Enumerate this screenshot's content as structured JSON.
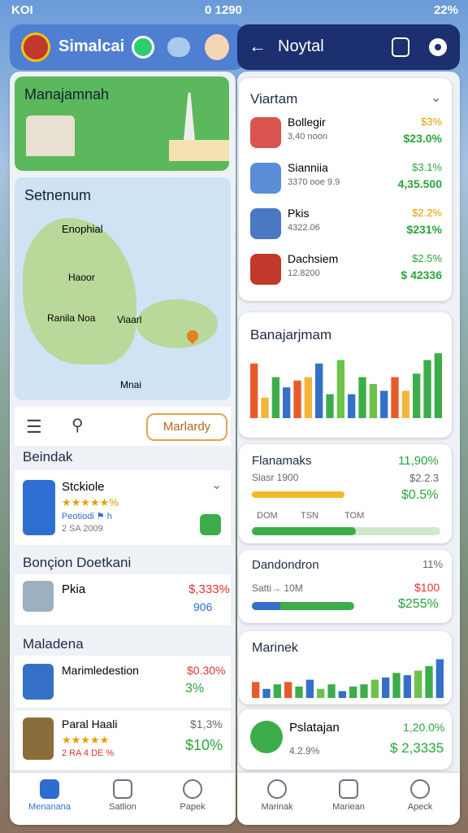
{
  "status": {
    "left": "KOI",
    "center": "0 1290",
    "right": "22%"
  },
  "left_header": {
    "title": "Simalcai"
  },
  "right_header": {
    "title": "Noytal"
  },
  "banner": {
    "title": "Manajamnah"
  },
  "map": {
    "title": "Setnenum",
    "pins": [
      "Enophial",
      "Haoor",
      "Ranila Noa",
      "Viaarl",
      "Mnai"
    ]
  },
  "toolbar": {
    "button": "Marlardy"
  },
  "list1": {
    "title": "Beindak",
    "item": {
      "name": "Stckiole",
      "rating": "★★★★★%",
      "sub1": "Peotiodi ⚑ h",
      "sub2": "2 SA 2009"
    }
  },
  "list2": {
    "title": "Bonçion Doetkani",
    "item": {
      "name": "Pkia",
      "price": "$,333%",
      "val": "906"
    }
  },
  "list3": {
    "title": "Maladena",
    "items": [
      {
        "name": "Marimledestion",
        "price": "$0.30%",
        "val": "3%"
      },
      {
        "name": "Paral Haali",
        "price": "$1,3%",
        "val": "$10%",
        "sub": "2 RA 4 DE %"
      }
    ]
  },
  "left_nav": [
    "Menanana",
    "Satlion",
    "Papek"
  ],
  "varam": {
    "title": "Viartam",
    "items": [
      {
        "name": "Bollegir",
        "sub": "3,40 noon",
        "pct": "$3%",
        "val": "$23.0%"
      },
      {
        "name": "Sianniia",
        "sub": "3370 ooe 9.9",
        "pct": "$3.1%",
        "val": "4,35.500"
      },
      {
        "name": "Pkis",
        "sub": "4322.06",
        "pct": "$2.2%",
        "val": "$231%"
      },
      {
        "name": "Dachsiem",
        "sub": "12.8200",
        "pct": "$2.5%",
        "val": "$ 42336"
      }
    ]
  },
  "chart1": {
    "title": "Banajarjmam"
  },
  "chart_data": [
    {
      "type": "bar",
      "title": "Banajarjmam",
      "categories": [
        "1",
        "2",
        "3",
        "4",
        "5",
        "6",
        "7",
        "8",
        "9",
        "10",
        "11",
        "12",
        "13",
        "14",
        "15",
        "16",
        "17",
        "18"
      ],
      "values": [
        80,
        30,
        60,
        45,
        55,
        60,
        80,
        35,
        85,
        35,
        60,
        50,
        40,
        60,
        40,
        65,
        85,
        95
      ],
      "colors": [
        "#e75b2a",
        "#f3b63b",
        "#3dad4b",
        "#3570c7",
        "#e75b2a",
        "#f3b63b",
        "#3570c7",
        "#3dad4b",
        "#6cc24a",
        "#3570c7",
        "#3dad4b",
        "#6cc24a",
        "#3570c7",
        "#e75b2a",
        "#f3b63b",
        "#3dad4b",
        "#3dad4b",
        "#3dad4b"
      ]
    },
    {
      "type": "bar",
      "title": "Marinek",
      "categories": [
        "1",
        "2",
        "3",
        "4",
        "5",
        "6",
        "7",
        "8",
        "9",
        "10",
        "11",
        "12",
        "13",
        "14",
        "15",
        "16",
        "17",
        "18"
      ],
      "values": [
        35,
        20,
        30,
        35,
        25,
        40,
        20,
        30,
        15,
        25,
        30,
        40,
        45,
        55,
        50,
        60,
        70,
        85
      ],
      "colors": [
        "#e75b2a",
        "#3570c7",
        "#3dad4b",
        "#e75b2a",
        "#3dad4b",
        "#3570c7",
        "#6cc24a",
        "#3dad4b",
        "#3570c7",
        "#3dad4b",
        "#3dad4b",
        "#6cc24a",
        "#3570c7",
        "#3dad4b",
        "#3570c7",
        "#6cc24a",
        "#3dad4b",
        "#3570c7"
      ]
    }
  ],
  "stat1": {
    "title": "Flanamaks",
    "sub": "Siasr 1900",
    "p1": "11,90%",
    "p2": "$2.2.3",
    "p3": "$0.5%",
    "labels": [
      "DOM",
      "TSN",
      "TOM"
    ],
    "progress": 0.55
  },
  "stat2": {
    "title": "Dandondron",
    "sub": "Satti→ 10M",
    "p1": "11%",
    "p2": "$100",
    "p3": "$255%",
    "progress": 0.5
  },
  "chart2": {
    "title": "Marinek"
  },
  "pal": {
    "title": "Pslatajan",
    "sub": "4.2.9%",
    "p1": "1,20.0%",
    "p2": "$ 2,3335"
  },
  "right_nav": [
    "Marinak",
    "Mariean",
    "Apeck"
  ]
}
